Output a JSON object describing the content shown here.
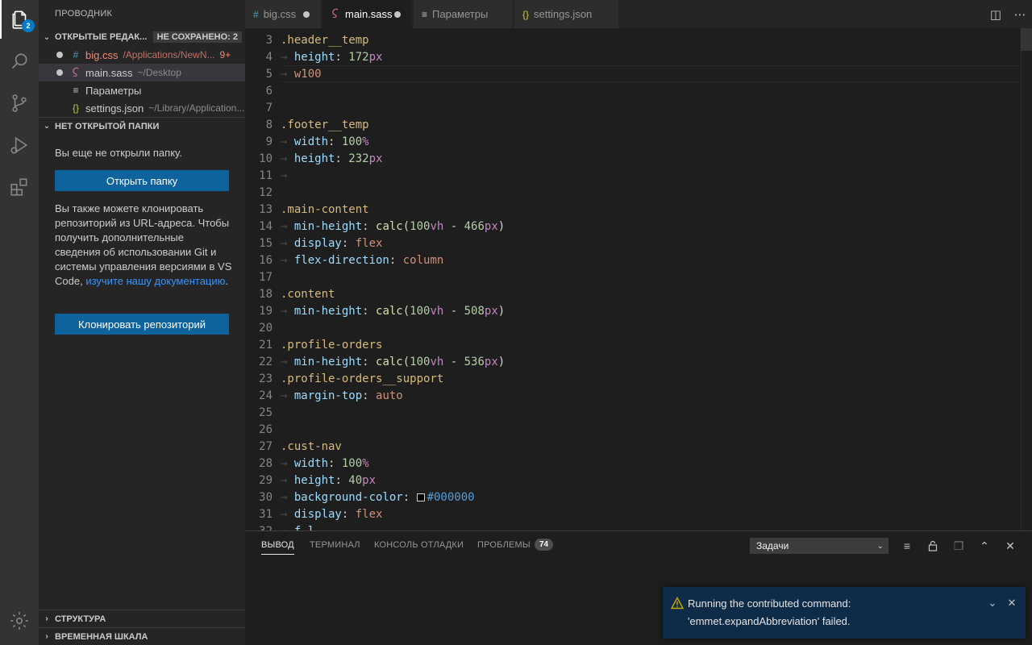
{
  "activity_bar": {
    "explorer_badge": "2",
    "items": [
      "files-icon",
      "search-icon",
      "source-control-icon",
      "run-debug-icon",
      "extensions-icon"
    ],
    "settings_icon": "gear-icon"
  },
  "sidebar": {
    "title": "ПРОВОДНИК",
    "open_editors": {
      "header": "ОТКРЫТЫЕ РЕДАК...",
      "unsaved": "НЕ СОХРАНЕНО: 2",
      "files": [
        {
          "icon": "#",
          "name": "big.css",
          "path": "/Applications/NewN...",
          "errors": "9+"
        },
        {
          "icon": "sass",
          "name": "main.sass",
          "path": "~/Desktop"
        },
        {
          "icon": "≡",
          "name": "Параметры",
          "path": ""
        },
        {
          "icon": "{}",
          "name": "settings.json",
          "path": "~/Library/Application..."
        }
      ]
    },
    "no_folder": {
      "header": "НЕТ ОТКРЫТОЙ ПАПКИ",
      "message": "Вы еще не открыли папку.",
      "open_button": "Открыть папку",
      "clone_text": "Вы также можете клонировать репозиторий из URL-адреса. Чтобы получить дополнительные сведения об использовании Git и системы управления версиями в VS Code,",
      "link_text": "изучите нашу документацию",
      "clone_text_end": ".",
      "clone_button": "Клонировать репозиторий"
    },
    "outline": "СТРУКТУРА",
    "timeline": "ВРЕМЕННАЯ ШКАЛА"
  },
  "tabs": [
    {
      "icon": "#",
      "label": "big.css",
      "dirty": true,
      "active": false
    },
    {
      "icon": "sass",
      "label": "main.sass",
      "dirty": true,
      "active": true
    },
    {
      "icon": "≡",
      "label": "Параметры",
      "dirty": false,
      "active": false
    },
    {
      "icon": "{}",
      "label": "settings.json",
      "dirty": false,
      "active": false
    }
  ],
  "editor": {
    "lines": [
      {
        "n": "3",
        "tokens": [
          [
            "sel",
            ".header__temp"
          ]
        ]
      },
      {
        "n": "4",
        "tokens": [
          [
            "arrow",
            "→ "
          ],
          [
            "prop",
            "height"
          ],
          [
            "txt",
            ": "
          ],
          [
            "num",
            "172"
          ],
          [
            "unit",
            "px"
          ]
        ]
      },
      {
        "n": "5",
        "tokens": [
          [
            "arrow",
            "→ "
          ],
          [
            "kw",
            "w100"
          ]
        ]
      },
      {
        "n": "6",
        "tokens": []
      },
      {
        "n": "7",
        "tokens": []
      },
      {
        "n": "8",
        "tokens": [
          [
            "sel",
            ".footer__temp"
          ]
        ]
      },
      {
        "n": "9",
        "tokens": [
          [
            "arrow",
            "→ "
          ],
          [
            "prop",
            "width"
          ],
          [
            "txt",
            ": "
          ],
          [
            "num",
            "100"
          ],
          [
            "unit",
            "%"
          ]
        ]
      },
      {
        "n": "10",
        "tokens": [
          [
            "arrow",
            "→ "
          ],
          [
            "prop",
            "height"
          ],
          [
            "txt",
            ": "
          ],
          [
            "num",
            "232"
          ],
          [
            "unit",
            "px"
          ]
        ]
      },
      {
        "n": "11",
        "tokens": [
          [
            "arrow",
            "→"
          ]
        ]
      },
      {
        "n": "12",
        "tokens": []
      },
      {
        "n": "13",
        "tokens": [
          [
            "sel",
            ".main-content"
          ]
        ]
      },
      {
        "n": "14",
        "tokens": [
          [
            "arrow",
            "→ "
          ],
          [
            "prop",
            "min-height"
          ],
          [
            "txt",
            ": "
          ],
          [
            "fn",
            "calc"
          ],
          [
            "txt",
            "("
          ],
          [
            "num",
            "100"
          ],
          [
            "unit",
            "vh"
          ],
          [
            "txt",
            " - "
          ],
          [
            "num",
            "466"
          ],
          [
            "unit",
            "px"
          ],
          [
            "txt",
            ")"
          ]
        ]
      },
      {
        "n": "15",
        "tokens": [
          [
            "arrow",
            "→ "
          ],
          [
            "prop",
            "display"
          ],
          [
            "txt",
            ": "
          ],
          [
            "kw",
            "flex"
          ]
        ]
      },
      {
        "n": "16",
        "tokens": [
          [
            "arrow",
            "→ "
          ],
          [
            "prop",
            "flex-direction"
          ],
          [
            "txt",
            ": "
          ],
          [
            "kw",
            "column"
          ]
        ]
      },
      {
        "n": "17",
        "tokens": []
      },
      {
        "n": "18",
        "tokens": [
          [
            "sel",
            ".content"
          ]
        ]
      },
      {
        "n": "19",
        "tokens": [
          [
            "arrow",
            "→ "
          ],
          [
            "prop",
            "min-height"
          ],
          [
            "txt",
            ": "
          ],
          [
            "fn",
            "calc"
          ],
          [
            "txt",
            "("
          ],
          [
            "num",
            "100"
          ],
          [
            "unit",
            "vh"
          ],
          [
            "txt",
            " - "
          ],
          [
            "num",
            "508"
          ],
          [
            "unit",
            "px"
          ],
          [
            "txt",
            ")"
          ]
        ]
      },
      {
        "n": "20",
        "tokens": []
      },
      {
        "n": "21",
        "tokens": [
          [
            "sel",
            ".profile-orders"
          ]
        ]
      },
      {
        "n": "22",
        "tokens": [
          [
            "arrow",
            "→ "
          ],
          [
            "prop",
            "min-height"
          ],
          [
            "txt",
            ": "
          ],
          [
            "fn",
            "calc"
          ],
          [
            "txt",
            "("
          ],
          [
            "num",
            "100"
          ],
          [
            "unit",
            "vh"
          ],
          [
            "txt",
            " - "
          ],
          [
            "num",
            "536"
          ],
          [
            "unit",
            "px"
          ],
          [
            "txt",
            ")"
          ]
        ]
      },
      {
        "n": "23",
        "tokens": [
          [
            "sel",
            ".profile-orders__support"
          ]
        ]
      },
      {
        "n": "24",
        "tokens": [
          [
            "arrow",
            "→ "
          ],
          [
            "prop",
            "margin-top"
          ],
          [
            "txt",
            ": "
          ],
          [
            "kw",
            "auto"
          ]
        ]
      },
      {
        "n": "25",
        "tokens": []
      },
      {
        "n": "26",
        "tokens": []
      },
      {
        "n": "27",
        "tokens": [
          [
            "sel",
            ".cust-nav"
          ]
        ]
      },
      {
        "n": "28",
        "tokens": [
          [
            "arrow",
            "→ "
          ],
          [
            "prop",
            "width"
          ],
          [
            "txt",
            ": "
          ],
          [
            "num",
            "100"
          ],
          [
            "unit",
            "%"
          ]
        ]
      },
      {
        "n": "29",
        "tokens": [
          [
            "arrow",
            "→ "
          ],
          [
            "prop",
            "height"
          ],
          [
            "txt",
            ": "
          ],
          [
            "num",
            "40"
          ],
          [
            "unit",
            "px"
          ]
        ]
      },
      {
        "n": "30",
        "tokens": [
          [
            "arrow",
            "→ "
          ],
          [
            "prop",
            "background-color"
          ],
          [
            "txt",
            ": "
          ],
          [
            "swatch",
            ""
          ],
          [
            "hex",
            "#000000"
          ]
        ]
      },
      {
        "n": "31",
        "tokens": [
          [
            "arrow",
            "→ "
          ],
          [
            "prop",
            "display"
          ],
          [
            "txt",
            ": "
          ],
          [
            "kw",
            "flex"
          ]
        ]
      },
      {
        "n": "32",
        "tokens": [
          [
            "arrow",
            "→ "
          ],
          [
            "prop",
            "f"
          ],
          [
            "txt",
            " "
          ],
          [
            "prop",
            "l"
          ]
        ]
      }
    ]
  },
  "panel": {
    "tabs": [
      "ВЫВОД",
      "ТЕРМИНАЛ",
      "КОНСОЛЬ ОТЛАДКИ",
      "ПРОБЛЕМЫ"
    ],
    "problems_count": "74",
    "output_channel": "Задачи"
  },
  "notification": {
    "line1": "Running the contributed command:",
    "line2": "'emmet.expandAbbreviation' failed."
  },
  "colors": {
    "accent": "#007acc",
    "button": "#0e639c",
    "error": "#f48771",
    "warning": "#cca700"
  }
}
